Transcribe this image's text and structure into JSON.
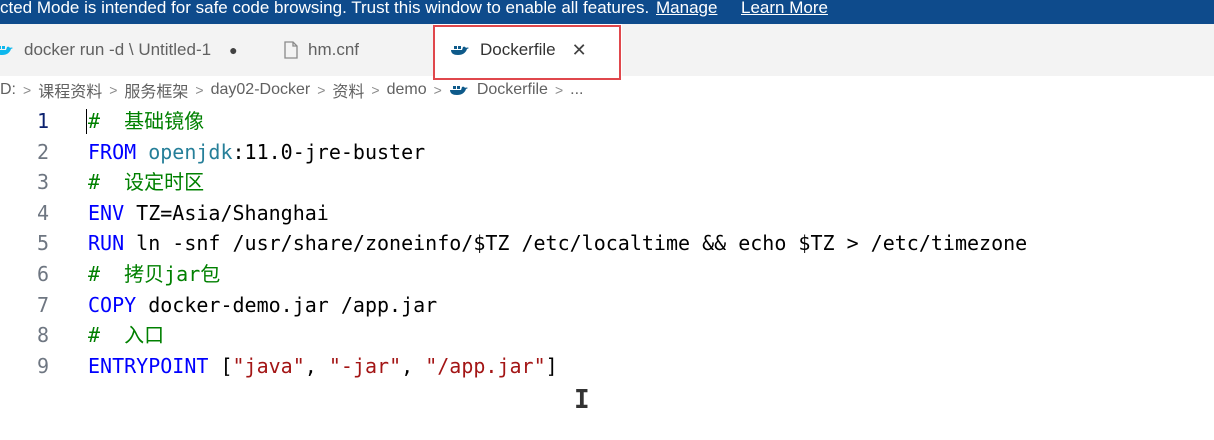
{
  "banner": {
    "message": "cted Mode is intended for safe code browsing. Trust this window to enable all features.",
    "manage": "Manage",
    "learn_more": "Learn More"
  },
  "tabs": [
    {
      "label": "docker run -d \\  Untitled-1",
      "dirty": "●",
      "icon": "docker-whale-icon"
    },
    {
      "label": "hm.cnf",
      "icon": "file-icon"
    },
    {
      "label": "Dockerfile",
      "close": "✕",
      "icon": "docker-whale-icon",
      "active": true
    }
  ],
  "breadcrumb": [
    "D:",
    "课程资料",
    "服务框架",
    "day02-Docker",
    "资料",
    "demo",
    "Dockerfile",
    "..."
  ],
  "editor": {
    "lines": [
      {
        "num": "1",
        "tokens": [
          {
            "t": "#  基础镜像",
            "c": "cmt"
          }
        ]
      },
      {
        "num": "2",
        "tokens": [
          {
            "t": "FROM",
            "c": "kw"
          },
          {
            "t": " ",
            "c": "plain"
          },
          {
            "t": "openjdk",
            "c": "img"
          },
          {
            "t": ":11.0-jre-buster",
            "c": "plain"
          }
        ]
      },
      {
        "num": "3",
        "tokens": [
          {
            "t": "#  设定时区",
            "c": "cmt"
          }
        ]
      },
      {
        "num": "4",
        "tokens": [
          {
            "t": "ENV",
            "c": "kw"
          },
          {
            "t": " TZ=Asia/Shanghai",
            "c": "plain"
          }
        ]
      },
      {
        "num": "5",
        "tokens": [
          {
            "t": "RUN",
            "c": "kw"
          },
          {
            "t": " ln -snf /usr/share/zoneinfo/$TZ /etc/localtime && echo $TZ > /etc/timezone",
            "c": "plain"
          }
        ]
      },
      {
        "num": "6",
        "tokens": [
          {
            "t": "#  拷贝jar包",
            "c": "cmt"
          }
        ]
      },
      {
        "num": "7",
        "tokens": [
          {
            "t": "COPY",
            "c": "kw"
          },
          {
            "t": " docker-demo.jar /app.jar",
            "c": "plain"
          }
        ]
      },
      {
        "num": "8",
        "tokens": [
          {
            "t": "#  入口",
            "c": "cmt"
          }
        ]
      },
      {
        "num": "9",
        "tokens": [
          {
            "t": "ENTRYPOINT",
            "c": "kw"
          },
          {
            "t": " [",
            "c": "plain"
          },
          {
            "t": "\"java\"",
            "c": "str"
          },
          {
            "t": ", ",
            "c": "plain"
          },
          {
            "t": "\"-jar\"",
            "c": "str"
          },
          {
            "t": ", ",
            "c": "plain"
          },
          {
            "t": "\"/app.jar\"",
            "c": "str"
          },
          {
            "t": "]",
            "c": "plain"
          }
        ]
      }
    ],
    "cursor_icon": "I"
  },
  "colors": {
    "banner_bg": "#0e4b8c",
    "comment": "#008000",
    "keyword": "#0000ff",
    "string": "#a31515",
    "image_name": "#267f99",
    "highlight_box": "#e0474c"
  }
}
